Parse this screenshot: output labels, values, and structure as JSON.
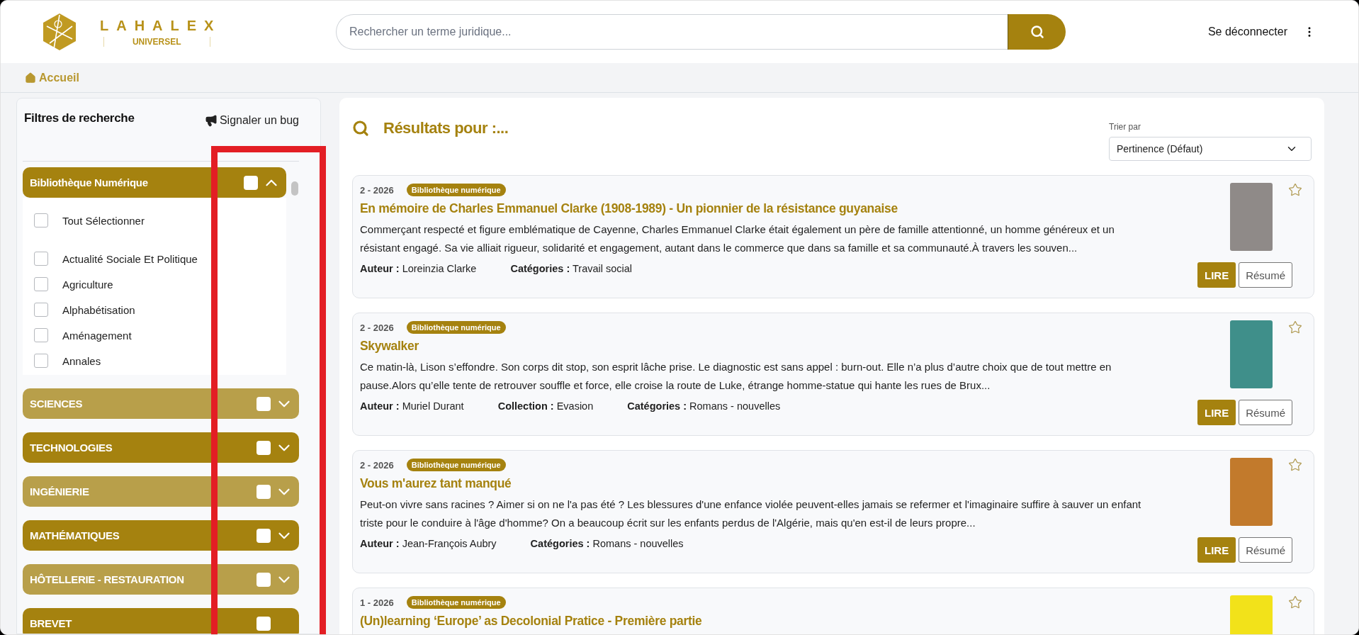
{
  "header": {
    "logo": {
      "name": "LAHALEX",
      "subtitle": "UNIVERSEL"
    },
    "search": {
      "placeholder": "Rechercher un terme juridique..."
    },
    "logout": "Se déconnecter"
  },
  "breadcrumb": {
    "label": "Accueil"
  },
  "filters": {
    "title": "Filtres de recherche",
    "report_bug": "Signaler un bug",
    "groups": [
      {
        "label": "Bibliothèque Numérique",
        "color": "#a5820f",
        "checked": false,
        "expanded": true,
        "items": [
          {
            "label": "Tout Sélectionner",
            "checked": false
          },
          {
            "label": "Actualité Sociale Et Politique",
            "checked": false
          },
          {
            "label": "Agriculture",
            "checked": false
          },
          {
            "label": "Alphabétisation",
            "checked": false
          },
          {
            "label": "Aménagement",
            "checked": false
          },
          {
            "label": "Annales",
            "checked": false
          }
        ]
      },
      {
        "label": "SCIENCES",
        "color": "#b89f4a",
        "checked": false,
        "expanded": false
      },
      {
        "label": "TECHNOLOGIES",
        "color": "#a5820f",
        "checked": false,
        "expanded": false
      },
      {
        "label": "INGÉNIERIE",
        "color": "#b89f4a",
        "checked": false,
        "expanded": false
      },
      {
        "label": "MATHÉMATIQUES",
        "color": "#a5820f",
        "checked": false,
        "expanded": false
      },
      {
        "label": "HÔTELLERIE - RESTAURATION",
        "color": "#b89f4a",
        "checked": false,
        "expanded": false
      },
      {
        "label": "BREVET",
        "color": "#a5820f",
        "checked": false,
        "expanded": false
      }
    ]
  },
  "results": {
    "title": "Résultats pour :...",
    "sort": {
      "label": "Trier par",
      "value": "Pertinence (Défaut)"
    },
    "items": [
      {
        "date": "2 - 2026",
        "tag": "Bibliothèque numérique",
        "title": "En mémoire de Charles Emmanuel Clarke (1908-1989) - Un pionnier de la résistance guyanaise",
        "description": "Commerçant respecté et figure emblématique de Cayenne, Charles Emmanuel Clarke était également un père de famille attentionné, un homme généreux et un résistant engagé. Sa vie alliait rigueur, solidarité et engagement, autant dans le commerce que dans sa famille et sa communauté.À travers les souven...",
        "meta": [
          {
            "label": "Auteur :",
            "value": "Loreinzia Clarke"
          },
          {
            "label": "Catégories :",
            "value": "Travail social"
          }
        ],
        "color": "#8f8a88",
        "starred": false,
        "read": "LIRE",
        "summary": "Résumé"
      },
      {
        "date": "2 - 2026",
        "tag": "Bibliothèque numérique",
        "title": "Skywalker",
        "description": "Ce matin-là, Lison s’effondre. Son corps dit stop, son esprit lâche prise. Le diagnostic est sans appel : burn-out. Elle n’a plus d’autre choix que de tout mettre en pause.Alors qu’elle tente de retrouver souffle et force, elle croise la route de Luke, étrange homme-statue qui hante les rues de Brux...",
        "meta": [
          {
            "label": "Auteur :",
            "value": "Muriel Durant"
          },
          {
            "label": "Collection :",
            "value": "Evasion"
          },
          {
            "label": "Catégories :",
            "value": "Romans - nouvelles"
          }
        ],
        "color": "#3f8f8a",
        "starred": false,
        "read": "LIRE",
        "summary": "Résumé"
      },
      {
        "date": "2 - 2026",
        "tag": "Bibliothèque numérique",
        "title": "Vous m'aurez tant manqué",
        "description": "Peut-on vivre sans racines ? Aimer si on ne l'a pas été ? Les blessures d'une enfance violée peuvent-elles jamais se refermer et l'imaginaire suffire à sauver un enfant triste pour le conduire à l'âge d'homme? On a beaucoup écrit sur les enfants perdus de l'Algérie, mais qu'en est-il de leurs propre...",
        "meta": [
          {
            "label": "Auteur :",
            "value": "Jean-François Aubry"
          },
          {
            "label": "Catégories :",
            "value": "Romans - nouvelles"
          }
        ],
        "color": "#c27a2c",
        "starred": false,
        "read": "LIRE",
        "summary": "Résumé"
      },
      {
        "date": "1 - 2026",
        "tag": "Bibliothèque numérique",
        "title": "(Un)learning ‘Europe’ as Decolonial Pratice - Première partie",
        "color": "#f2e21a",
        "starred": false
      }
    ]
  },
  "highlight_frame": {
    "shown": true
  }
}
